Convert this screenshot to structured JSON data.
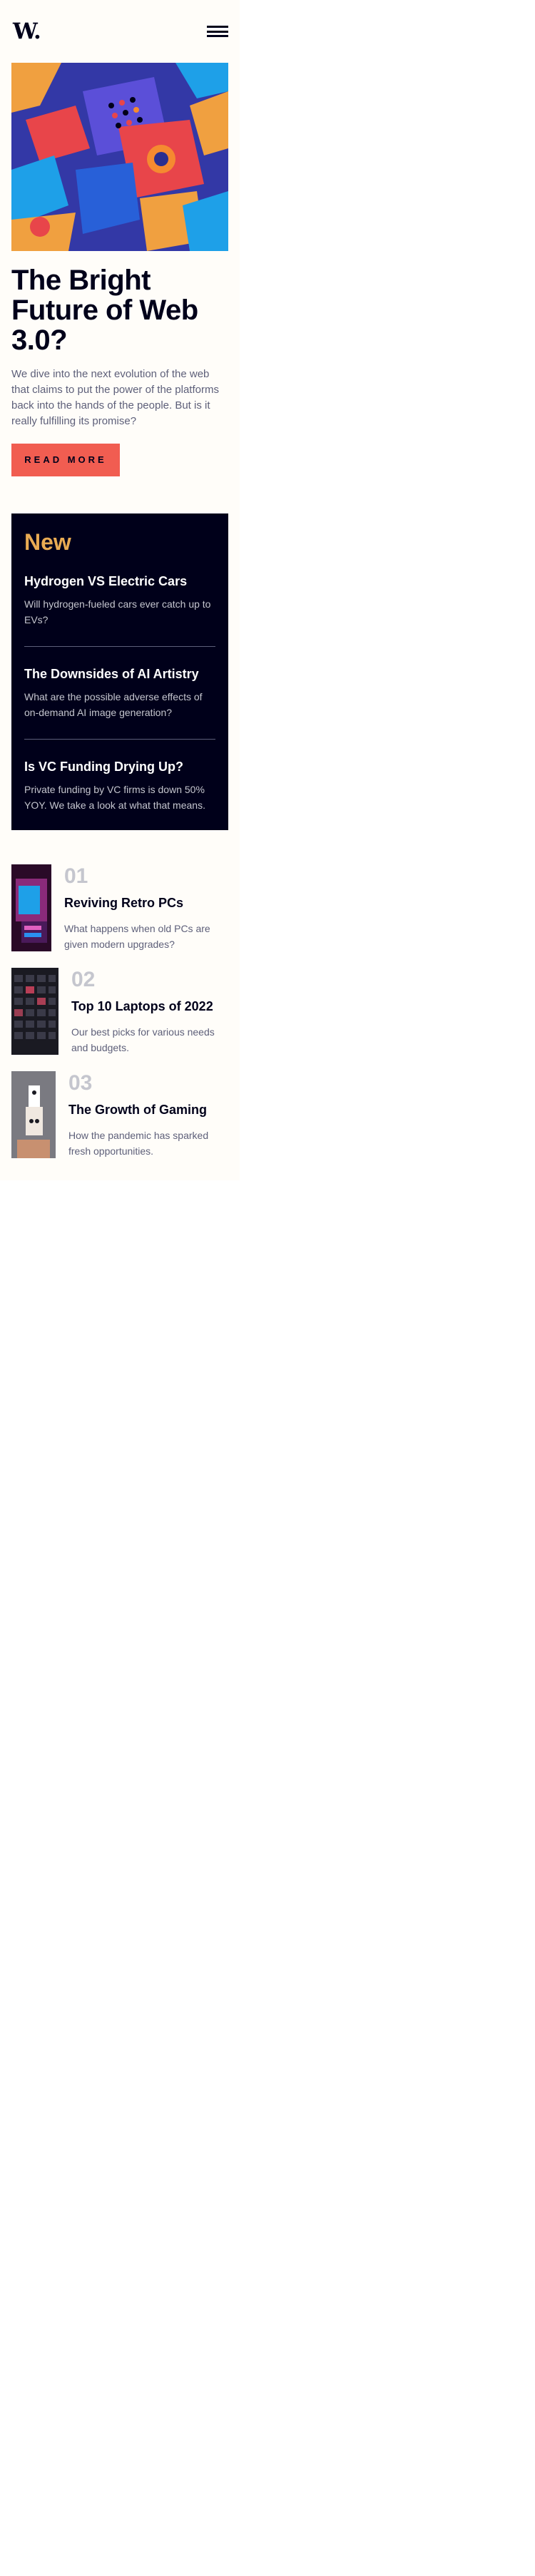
{
  "header": {
    "logo_text": "W.",
    "menu_icon": "hamburger-menu-icon"
  },
  "hero": {
    "image_name": "web3-abstract-3d-blocks",
    "title": "The Bright Future of Web 3.0?",
    "description": "We dive into the next evolution of the web that claims to put the power of the platforms back into the hands of the people. But is it really fulfilling its promise?",
    "button_label": "READ MORE"
  },
  "new_section": {
    "heading": "New",
    "items": [
      {
        "title": "Hydrogen VS Electric Cars",
        "description": "Will hydrogen-fueled cars ever catch up to EVs?"
      },
      {
        "title": "The Downsides of AI Artistry",
        "description": "What are the possible adverse effects of on-demand AI image generation?"
      },
      {
        "title": "Is VC Funding Drying Up?",
        "description": "Private funding by VC firms is down 50% YOY. We take a look at what that means."
      }
    ]
  },
  "top_articles": [
    {
      "number": "01",
      "title": "Reviving Retro PCs",
      "description": "What happens when old PCs are given modern upgrades?"
    },
    {
      "number": "02",
      "title": "Top 10 Laptops of 2022",
      "description": "Our best picks for various needs and budgets."
    },
    {
      "number": "03",
      "title": "The Growth of Gaming",
      "description": "How the pandemic has sparked fresh opportunities."
    }
  ],
  "colors": {
    "navy": "#00001a",
    "red": "#f15d51",
    "orange": "#e9ab53",
    "grayish_blue": "#5d5f79",
    "grayish_light": "#c5c6ce",
    "off_white": "#fffdf9"
  }
}
